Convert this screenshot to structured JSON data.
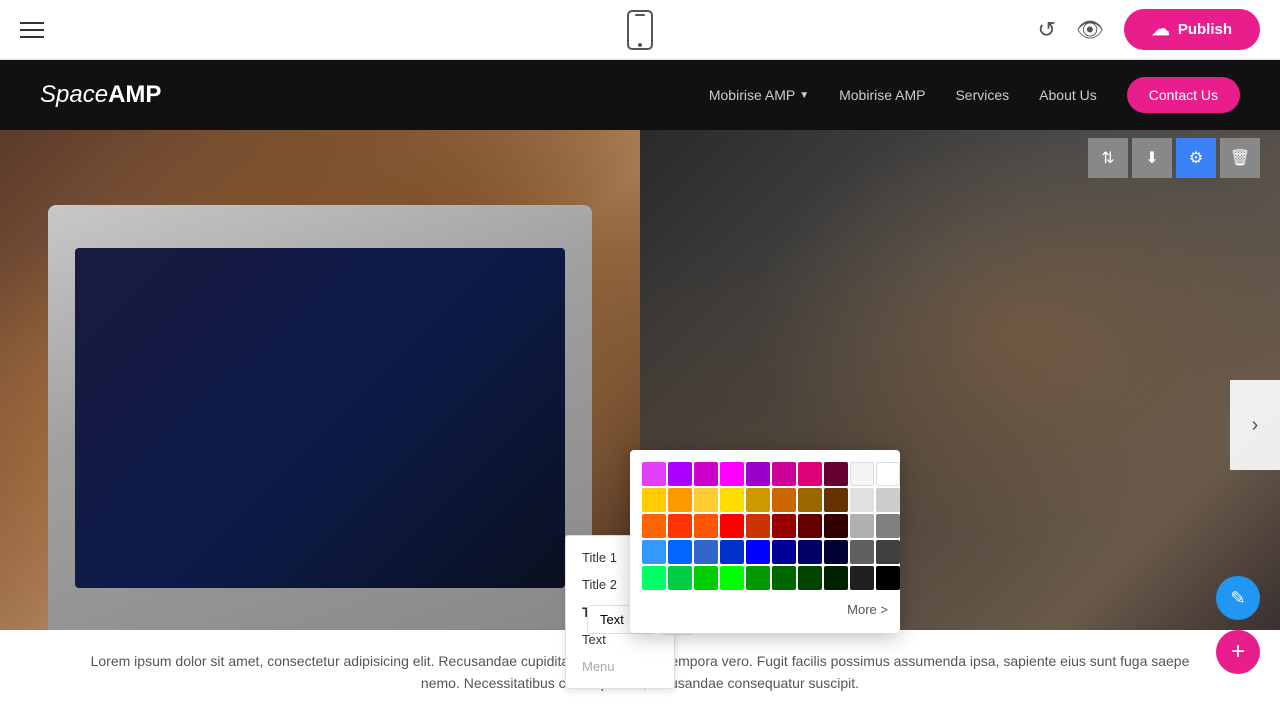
{
  "toolbar": {
    "publish_label": "Publish"
  },
  "nav": {
    "logo_italic": "Space",
    "logo_bold": "AMP",
    "links": [
      {
        "label": "Mobirise AMP",
        "hasArrow": true
      },
      {
        "label": "Mobirise AMP",
        "hasArrow": false
      },
      {
        "label": "Services",
        "hasArrow": false
      },
      {
        "label": "About Us",
        "hasArrow": false
      }
    ],
    "contact_label": "Contact Us"
  },
  "color_picker": {
    "more_label": "More >",
    "colors_row1": [
      "#e040fb",
      "#aa00ff",
      "#cc00cc",
      "#ff00ff",
      "#9900cc",
      "#cc0099",
      "#ffffff"
    ],
    "colors_row2": [
      "#ffcc00",
      "#ff9900",
      "#ffcc33",
      "#ffdd00",
      "#cc9900",
      "#cc6600",
      "#e0e0e0"
    ],
    "colors_row3": [
      "#ff6600",
      "#ff3300",
      "#ff5500",
      "#ff0000",
      "#cc3300",
      "#990000",
      "#c0c0c0"
    ],
    "colors_row4": [
      "#3399ff",
      "#0066ff",
      "#3366cc",
      "#0033cc",
      "#0000ff",
      "#000099",
      "#a0a0a0"
    ],
    "colors_row5": [
      "#00ff66",
      "#00cc44",
      "#00cc00",
      "#00ff00",
      "#009900",
      "#006600",
      "#000000"
    ]
  },
  "dropdown": {
    "items": [
      {
        "label": "Title 1",
        "style": "title1"
      },
      {
        "label": "Title 2",
        "style": "title2"
      },
      {
        "label": "Title 3",
        "style": "title3"
      },
      {
        "label": "Text",
        "style": "text"
      },
      {
        "label": "Menu",
        "style": "menu"
      }
    ]
  },
  "bottom_bar": {
    "text_label": "Text",
    "arrow_label": "▲"
  },
  "hero": {
    "body_text": "Lorem ipsum dolor sit amet, consectetur adipisicing elit. Recusandae cupiditate rerum ipsum tempora vero. Fugit facilis possimus assumenda ipsa, sapiente eius sunt fuga saepe nemo. Necessitatibus consequuntur, recusandae consequatur suscipit."
  }
}
